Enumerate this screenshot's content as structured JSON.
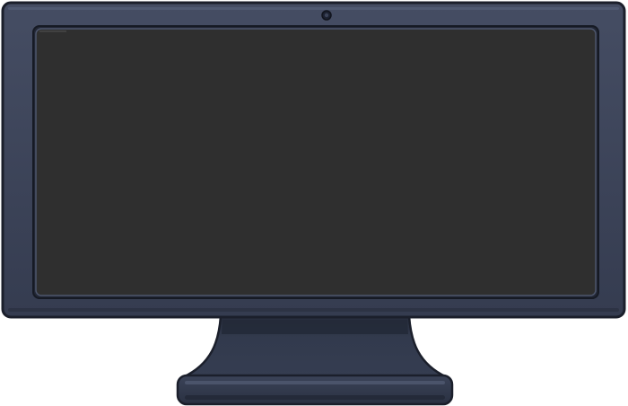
{
  "colors": {
    "bezel": "#3a4256",
    "bezel_highlight": "#4a5369",
    "outline": "#1b1f2b",
    "screen": "#2f2f2f",
    "stand": "#323a4d",
    "stand_shadow": "#262c3b",
    "background": "#ffffff"
  },
  "icons": {
    "camera": "webcam-icon"
  },
  "screen": {
    "state": "off"
  }
}
